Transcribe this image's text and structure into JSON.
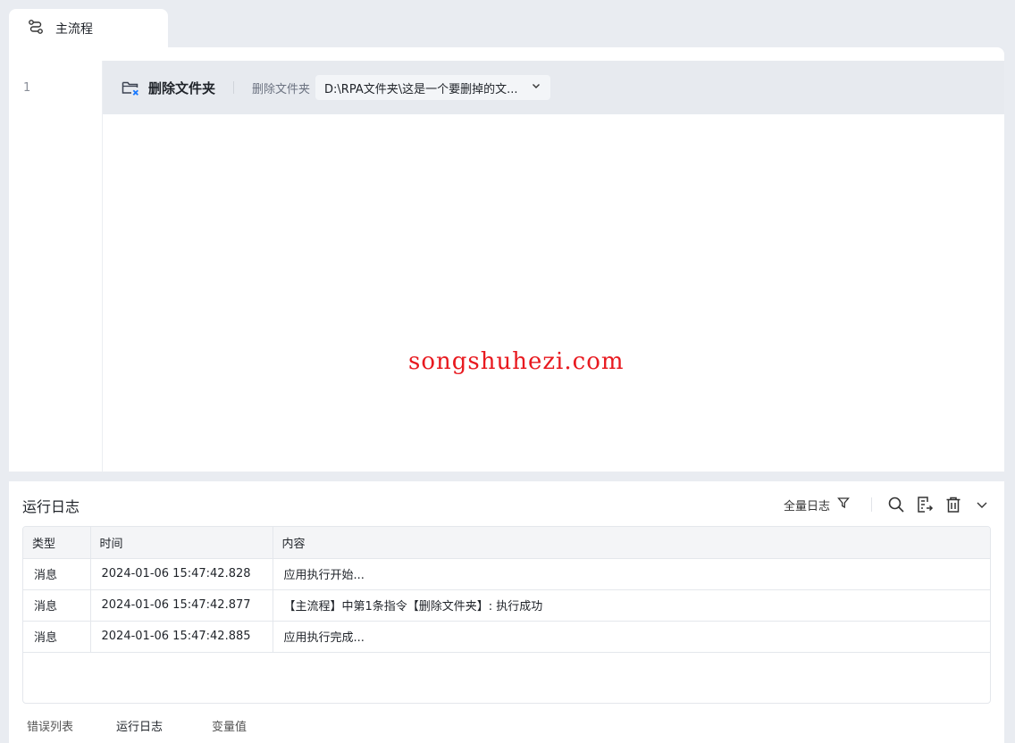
{
  "tab": {
    "icon": "flow-icon",
    "label": "主流程"
  },
  "editor": {
    "line_number": "1",
    "command": {
      "icon": "folder-delete-icon",
      "title": "删除文件夹",
      "param_label": "删除文件夹",
      "param_value": "D:\\RPA文件夹\\这是一个要删掉的文..."
    },
    "watermark": "songshuhezi.com"
  },
  "log": {
    "title": "运行日志",
    "filter_label": "全量日志",
    "columns": [
      "类型",
      "时间",
      "内容"
    ],
    "rows": [
      {
        "type": "消息",
        "time": "2024-01-06 15:47:42.828",
        "content": "应用执行开始..."
      },
      {
        "type": "消息",
        "time": "2024-01-06 15:47:42.877",
        "content": "【主流程】中第1条指令【删除文件夹】: 执行成功"
      },
      {
        "type": "消息",
        "time": "2024-01-06 15:47:42.885",
        "content": "应用执行完成..."
      }
    ],
    "bottom_tabs": [
      "错误列表",
      "运行日志",
      "变量值"
    ]
  },
  "colors": {
    "accent": "#1677ff",
    "watermark": "#e8191f",
    "background": "#e9ecf1"
  }
}
